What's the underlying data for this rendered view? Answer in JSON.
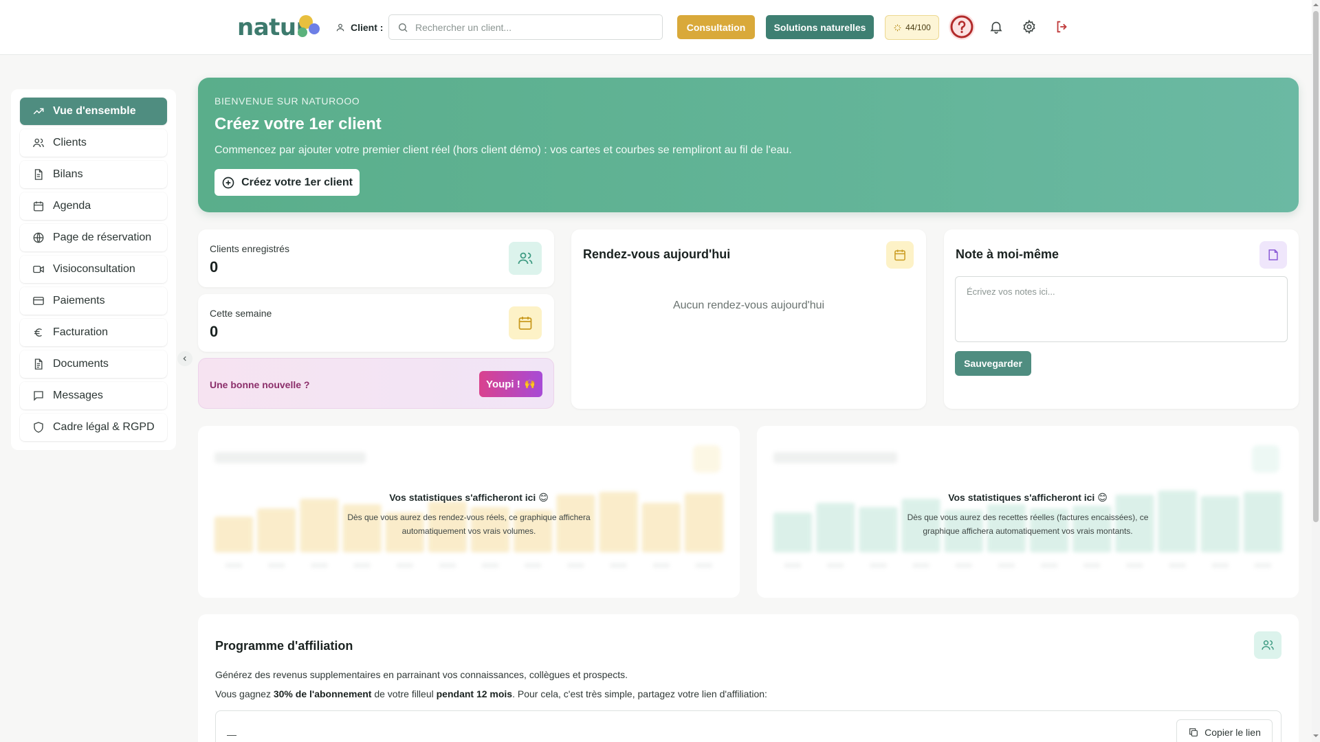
{
  "header": {
    "logo_text": "natur",
    "client_label": "Client :",
    "search_placeholder": "Rechercher un client...",
    "consultation_label": "Consultation",
    "solutions_label": "Solutions naturelles",
    "score_label": "44/100",
    "colors": {
      "consultation": "#d9a93a",
      "solutions": "#3e7f72",
      "help": "#b22a2a"
    }
  },
  "sidebar": {
    "items": [
      {
        "label": "Vue d'ensemble",
        "icon": "trending-up-icon",
        "active": true
      },
      {
        "label": "Clients",
        "icon": "users-icon"
      },
      {
        "label": "Bilans",
        "icon": "file-text-icon"
      },
      {
        "label": "Agenda",
        "icon": "calendar-icon"
      },
      {
        "label": "Page de réservation",
        "icon": "globe-icon"
      },
      {
        "label": "Visioconsultation",
        "icon": "video-icon"
      },
      {
        "label": "Paiements",
        "icon": "credit-card-icon"
      },
      {
        "label": "Facturation",
        "icon": "euro-icon"
      },
      {
        "label": "Documents",
        "icon": "document-icon"
      },
      {
        "label": "Messages",
        "icon": "message-icon"
      },
      {
        "label": "Cadre légal & RGPD",
        "icon": "shield-icon"
      }
    ]
  },
  "hero": {
    "kicker": "BIENVENUE SUR NATUROOO",
    "title": "Créez votre 1er client",
    "description": "Commencez par ajouter votre premier client réel (hors client démo) : vos cartes et courbes se rempliront au fil de l'eau.",
    "button_label": "Créez votre 1er client"
  },
  "stats": {
    "clients": {
      "label": "Clients enregistrés",
      "value": "0"
    },
    "week": {
      "label": "Cette semaine",
      "value": "0"
    }
  },
  "promo": {
    "text": "Une bonne nouvelle ?",
    "button_label": "Youpi !",
    "button_emoji": "🙌"
  },
  "rdv": {
    "title": "Rendez-vous aujourd'hui",
    "empty_text": "Aucun rendez-vous aujourd'hui"
  },
  "note": {
    "title": "Note à moi-même",
    "placeholder": "Écrivez vos notes ici...",
    "save_label": "Sauvegarder"
  },
  "chart_rdv": {
    "overlay_title": "Vos statistiques s'afficheront ici 😊",
    "overlay_desc": "Dès que vous aurez des rendez-vous réels, ce graphique affichera automatiquement vos vrais volumes."
  },
  "chart_revenus": {
    "overlay_title": "Vos statistiques s'afficheront ici 😊",
    "overlay_desc": "Dès que vous aurez des recettes réelles (factures encaissées), ce graphique affichera automatiquement vos vrais montants."
  },
  "affiliation": {
    "title": "Programme d'affiliation",
    "line1": "Générez des revenus supplementaires en parrainant vos connaissances, collègues et prospects.",
    "line2_prefix": "Vous gagnez ",
    "line2_bold1": "30% de l'abonnement",
    "line2_mid": " de votre filleul ",
    "line2_bold2": "pendant 12 mois",
    "line2_suffix": ". Pour cela, c'est très simple, partagez votre lien d'affiliation:",
    "link_text": "—",
    "copy_label": "Copier le lien"
  }
}
